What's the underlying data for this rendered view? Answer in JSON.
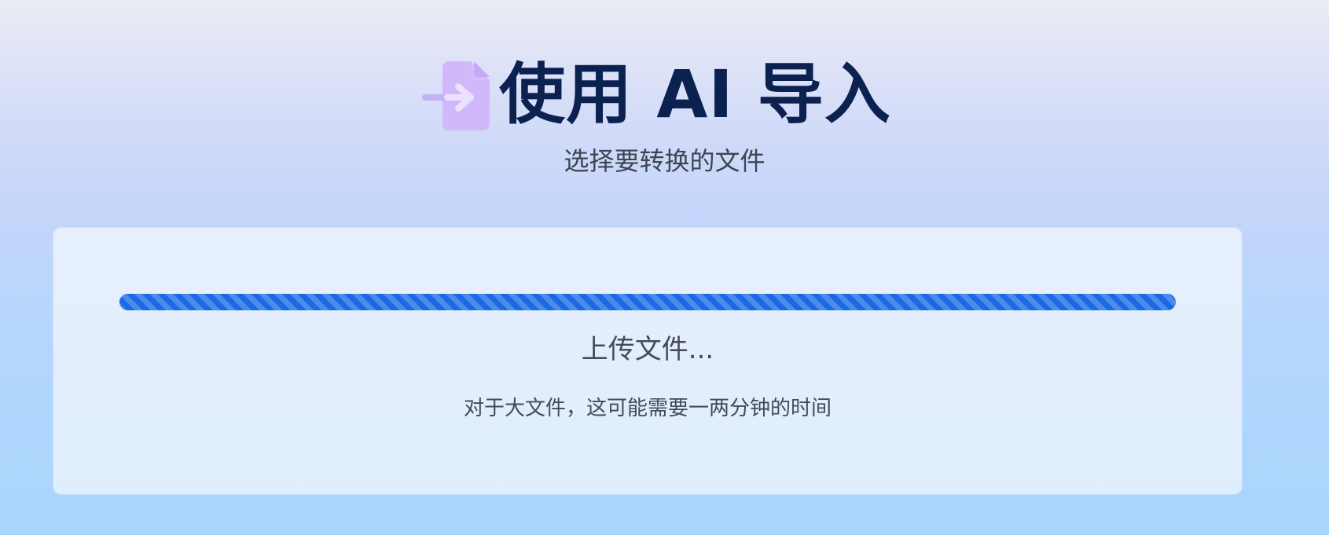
{
  "header": {
    "icon": "file-import-icon",
    "title": "使用 AI 导入",
    "subtitle": "选择要转换的文件"
  },
  "upload": {
    "progress": 1.0,
    "status": "上传文件...",
    "hint": "对于大文件，这可能需要一两分钟的时间"
  },
  "colors": {
    "title": "#0b2150",
    "icon": "#cdb7fb",
    "progress": "#1a6ae6",
    "text": "#444a56"
  }
}
